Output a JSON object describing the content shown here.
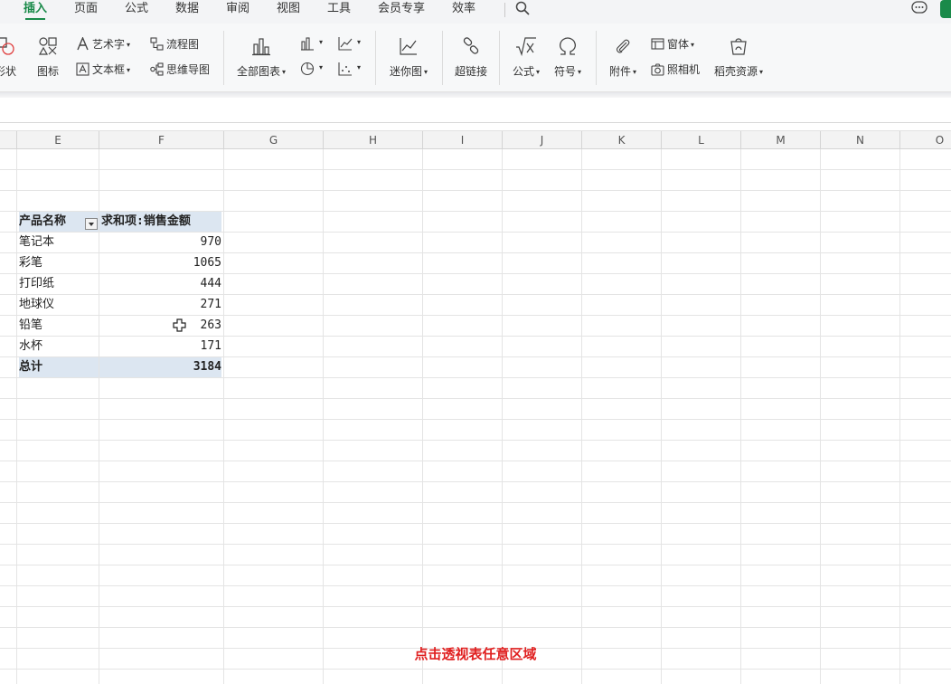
{
  "tabs": [
    {
      "label": "插入",
      "active": true
    },
    {
      "label": "页面"
    },
    {
      "label": "公式"
    },
    {
      "label": "数据"
    },
    {
      "label": "审阅"
    },
    {
      "label": "视图"
    },
    {
      "label": "工具"
    },
    {
      "label": "会员专享"
    },
    {
      "label": "效率"
    }
  ],
  "ribbon": {
    "shape_label": "形状",
    "icon_label": "图标",
    "wordart_label": "艺术字",
    "textbox_label": "文本框",
    "flowchart_label": "流程图",
    "mindmap_label": "思维导图",
    "allcharts_label": "全部图表",
    "sparkline_label": "迷你图",
    "hyperlink_label": "超链接",
    "formula_label": "公式",
    "symbol_label": "符号",
    "attachment_label": "附件",
    "window_label": "窗体",
    "camera_label": "照相机",
    "resources_label": "稻壳资源"
  },
  "columns": [
    "E",
    "F",
    "G",
    "H",
    "I",
    "J",
    "K",
    "L",
    "M",
    "N",
    "O"
  ],
  "pivot": {
    "header_name": "产品名称",
    "header_value": "求和项:销售金额",
    "rows": [
      {
        "name": "笔记本",
        "value": "970"
      },
      {
        "name": "彩笔",
        "value": "1065"
      },
      {
        "name": "打印纸",
        "value": "444"
      },
      {
        "name": "地球仪",
        "value": "271"
      },
      {
        "name": "铅笔",
        "value": "263"
      },
      {
        "name": "水杯",
        "value": "171"
      }
    ],
    "total_label": "总计",
    "total_value": "3184"
  },
  "caption": "点击透视表任意区域",
  "colors": {
    "accent": "#1a8a4a",
    "pivot_header_bg": "#dce6f1",
    "caption": "#e02020"
  }
}
